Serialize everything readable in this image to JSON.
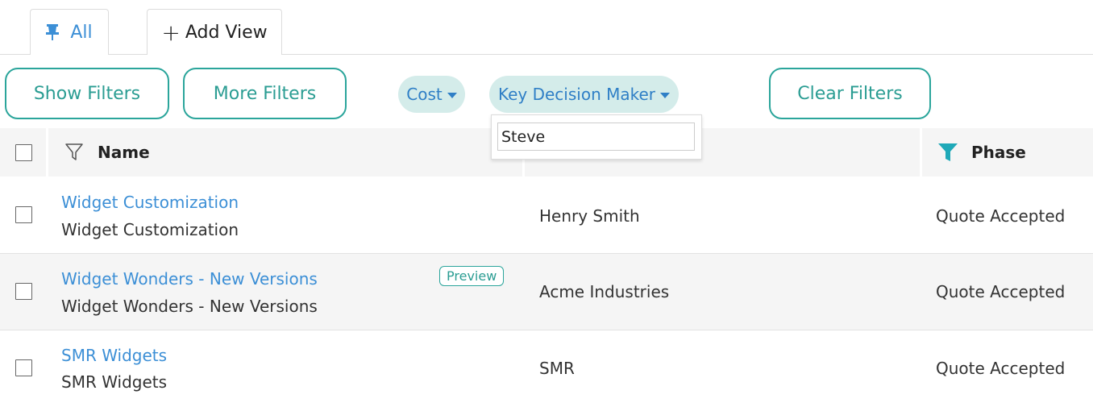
{
  "tabs": {
    "all_label": "All",
    "add_label": "Add View",
    "add_plus": "+"
  },
  "filters": {
    "show_filters": "Show Filters",
    "more_filters": "More Filters",
    "cost": "Cost",
    "key_decision_maker": "Key Decision Maker",
    "clear_filters": "Clear Filters",
    "kdm_search_value": "Steve"
  },
  "table": {
    "headers": {
      "name": "Name",
      "phase": "Phase"
    },
    "rows": [
      {
        "name_link": "Widget Customization",
        "name_sub": "Widget Customization",
        "company": "Henry Smith",
        "phase": "Quote Accepted",
        "badge": ""
      },
      {
        "name_link": "Widget Wonders - New Versions",
        "name_sub": "Widget Wonders - New Versions",
        "company": "Acme Industries",
        "phase": "Quote Accepted",
        "badge": "Preview"
      },
      {
        "name_link": "SMR Widgets",
        "name_sub": "SMR Widgets",
        "company": "SMR",
        "phase": "Quote Accepted",
        "badge": ""
      }
    ]
  },
  "colors": {
    "accent_teal": "#2ba59b",
    "link_blue": "#3c8fd6",
    "pill_bg": "#d4ecea"
  },
  "icons": {
    "pin": "pin-icon",
    "filter_outline": "filter-outline-icon",
    "filter_filled": "filter-filled-icon",
    "caret": "caret-down-icon"
  }
}
